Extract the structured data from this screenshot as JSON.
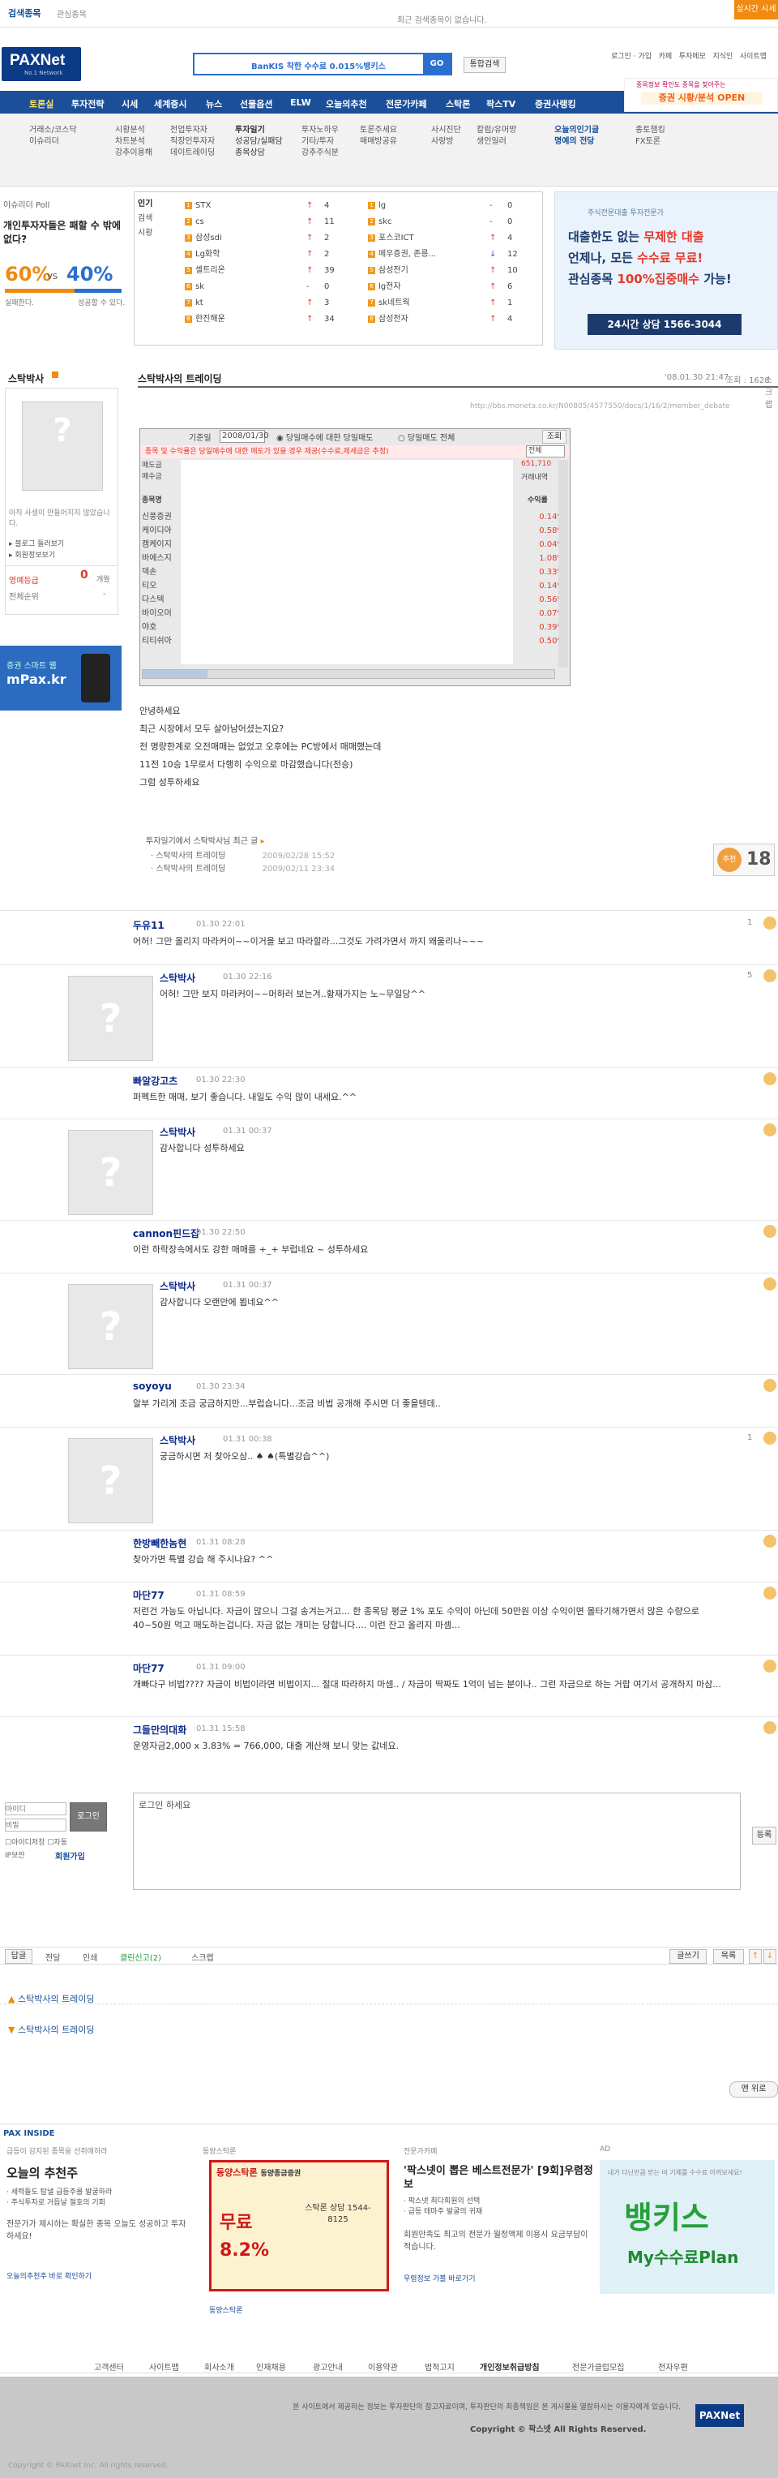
{
  "top": {
    "search_label": "검색종목",
    "stock_link": "관심종목",
    "notice": "최근 검색종목이 없습니다.",
    "live_button": "실시간 시세"
  },
  "header": {
    "logo": "PAXNet",
    "logo_sub": "No.1 Network",
    "search_banner": "BanKIS 착한 수수료 0.015%뱅키스",
    "go_button": "GO",
    "total_search_button": "통합검색",
    "links": [
      "로그인",
      "가입",
      "카페",
      "투자메모",
      "지식인",
      "사이트맵"
    ],
    "promo": "종목정보 확인도 종목을 찾아주는",
    "promo2": "증권 시황/분석 OPEN"
  },
  "nav": [
    "토론실",
    "투자전략",
    "시세",
    "세계증시",
    "뉴스",
    "선물옵션",
    "ELW",
    "오늘의추천",
    "전문가카페",
    "스탁론",
    "팍스TV",
    "증권사랭킹"
  ],
  "subnav": [
    [
      "거래소/코스닥",
      "이슈리더"
    ],
    [
      "시황분석",
      "차트분석",
      "강추이용해"
    ],
    [
      "전업투자자",
      "직장인투자자",
      "데이트레이딩"
    ],
    [
      "투자일기",
      "성공담/실패담",
      "종목상담"
    ],
    [
      "투자노하우",
      "기타/투자",
      "강추주식분"
    ],
    [
      "토론주세요",
      "매매방공유"
    ],
    [
      "사시진단",
      "사랑방"
    ],
    [
      "칼럼/유머방",
      "생인일러"
    ],
    [
      "오늘의인기글",
      "명예의 전당"
    ],
    [
      "종토챔킹",
      "FX토론"
    ]
  ],
  "poll": {
    "header": "이슈리더 Poll",
    "question": "개인투자자들은 패할 수 밖에 없다?",
    "pct_a": "60%",
    "vs": "VS",
    "pct_b": "40%",
    "label_a": "실패한다.",
    "label_b": "성공할 수 있다."
  },
  "ranking": {
    "side": [
      "인기",
      "검색",
      "시황"
    ],
    "left": [
      {
        "rank": "1",
        "name": "STX",
        "dir": "up",
        "change": "4"
      },
      {
        "rank": "2",
        "name": "cs",
        "dir": "up",
        "change": "11"
      },
      {
        "rank": "3",
        "name": "삼성sdi",
        "dir": "up",
        "change": "2"
      },
      {
        "rank": "4",
        "name": "Lg화학",
        "dir": "up",
        "change": "2"
      },
      {
        "rank": "5",
        "name": "셀트리온",
        "dir": "up",
        "change": "39"
      },
      {
        "rank": "6",
        "name": "sk",
        "dir": "none",
        "change": "0"
      },
      {
        "rank": "7",
        "name": "kt",
        "dir": "up",
        "change": "3"
      },
      {
        "rank": "8",
        "name": "한진해운",
        "dir": "up",
        "change": "34"
      }
    ],
    "right": [
      {
        "rank": "1",
        "name": "lg",
        "dir": "none",
        "change": "0"
      },
      {
        "rank": "2",
        "name": "skc",
        "dir": "none",
        "change": "0"
      },
      {
        "rank": "3",
        "name": "포스코ICT",
        "dir": "up",
        "change": "4"
      },
      {
        "rank": "4",
        "name": "메우증권, 존릉...",
        "dir": "dn",
        "change": "12"
      },
      {
        "rank": "5",
        "name": "삼성전기",
        "dir": "up",
        "change": "10"
      },
      {
        "rank": "6",
        "name": "lg전자",
        "dir": "up",
        "change": "6"
      },
      {
        "rank": "7",
        "name": "sk네트웍",
        "dir": "up",
        "change": "1"
      },
      {
        "rank": "8",
        "name": "삼성전자",
        "dir": "up",
        "change": "4"
      }
    ]
  },
  "ad_right": {
    "line1": "주식전문대출 투자전문가",
    "line2": "대출한도 없는",
    "hl1": "무제한 대출",
    "line3": "언제나, 모든",
    "hl2": "수수료 무료!",
    "line4": "관심종목",
    "hl3": "100%집중매수",
    "line5": "가능!",
    "phone": "24시간 상담 1566-3044"
  },
  "profile": {
    "name": "스탁박사",
    "note": "아직 사생이 만들어지지 않았습니다.",
    "blog": "블로그 들러보기",
    "book": "회원정보보기",
    "rank_label": "영예등급",
    "rank_value": "0",
    "rank_unit": "개월",
    "total_label": "전체순위",
    "total_value": "-",
    "mpax": "증권 스마트 웹",
    "mpax2": "mPax.kr"
  },
  "post": {
    "title": "스탁박사의 트레이딩",
    "date": "'08.01.30 21:47",
    "hits": "조회 : 1628",
    "extra": "스크랩",
    "url": "http://bbs.moneta.co.kr/N00805/4577550/docs/1/16/2/member_debate",
    "grid_date_label": "기준일",
    "grid_date": "2008/01/30",
    "grid_tab1": "당일매수에 대한 당일매도",
    "grid_tab2": "당일매도 전체",
    "grid_btn": "조회",
    "grid_all": "전체",
    "grid_warn": "종목 및 수익률은 당일매수에 대한 매도가 있을 경우 제공(수수료,제세금은 추정)",
    "left_head": [
      "매도금",
      "매수금"
    ],
    "col_name": "종목명",
    "col_yield": "수익률",
    "col_amt": "거래내역",
    "top_amt": "651,710",
    "names": [
      "신풍증권",
      "케이디아",
      "캠케이지",
      "바에스지",
      "덱손",
      "티오",
      "다스텍",
      "바이오머",
      "야호",
      "티티쉬아"
    ],
    "yields": [
      "0.14%",
      "0.58%",
      "0.04%",
      "1.08%",
      "0.33%",
      "0.14%",
      "0.56%",
      "0.07%",
      "0.39%",
      "0.50%"
    ],
    "body": [
      "안녕하세요",
      "최근 시장에서 모두 살아남어셨는지요?",
      "전 명량한계로 오전매매는 없었고 오후에는 PC방에서 매매했는데",
      "11전 10승 1무로서 다행히 수익으로 마감했습니다(전승)",
      "그럼 성투하세요"
    ],
    "related_title": "투자일기에서 스탁박사님 최근 글",
    "related": [
      {
        "title": "스탁박사의 트레이딩",
        "date": "2009/02/28 15:52"
      },
      {
        "title": "스탁박사의 트레이딩",
        "date": "2009/02/11 23:34"
      }
    ],
    "recommend_label": "추천",
    "recommend": "18"
  },
  "comments": [
    {
      "name": "두유11",
      "date": "01.30 22:01",
      "text": "어허! 그만 올리지 마라커이~~이거을 보고 따라할라...그것도 가려가면서 까지 왜울리나~~~",
      "badge": "1"
    },
    {
      "name": "스탁박사",
      "date": "01.30 22:16",
      "text": "어허! 그만 보지 마라커이~~머하러 보는겨..황재가지는 노~무일당^^",
      "reply": true,
      "badge": "5"
    },
    {
      "name": "빠알강고츠",
      "date": "01.30 22:30",
      "text": "퍼펙트한 매매, 보기 좋습니다. 내일도 수익 많이 내세요.^^"
    },
    {
      "name": "스탁박사",
      "date": "01.31 00:37",
      "text": "감사합니다 성투하세요",
      "reply": true
    },
    {
      "name": "cannon핀드잡",
      "date": "01.30 22:50",
      "text": "이런 하락장속에서도 강한 매매를 +_+ 부럽네요 ~ 성투하세요"
    },
    {
      "name": "스탁박사",
      "date": "01.31 00:37",
      "text": "감사합니다 오랜만에 뵙네요^^",
      "reply": true
    },
    {
      "name": "soyoyu",
      "date": "01.30 23:34",
      "text": "알부 가리게 조금 궁금하지만...부럽습니다...조금 비법 공개해 주시면 더 좋을텐데.."
    },
    {
      "name": "스탁박사",
      "date": "01.31 00:38",
      "text": "궁금하시면 저 찾아오삼.. ♠ ♠(특별강습^^)",
      "reply": true,
      "badge": "1"
    },
    {
      "name": "한방빼한놈현",
      "date": "01.31 08:28",
      "text": "찾아가면 특별 강습 해 주시나요? ^^"
    },
    {
      "name": "마단77",
      "date": "01.31 08:59",
      "text": "저런건 가능도 아닙니다. 자금이 많으니 그걸 송겨는거고... 한 종목당 평균 1% 포도 수익이 아닌데 50만원 이상 수익이면 몰타기해가면서 많은 수량으로 40~50원 먹고 매도하는겁니다. 자금 없는 개미는 당합니다.... 이런 잔고 올리지 마셈..."
    },
    {
      "name": "마단77",
      "date": "01.31 09:00",
      "text": "개빠다구 비법???? 자금이 비법이라면 비법이지... 절대 따라하지 마셈.. / 자금이 딱짜도 1억이 넘는 분이나.. 그런 자금으로 하는 거랍 여기서 공개하지 마삼..."
    },
    {
      "name": "그들만의대화",
      "date": "01.31 15:58",
      "text": "운영자금2,000 x 3.83% = 766,000, 대출 계산해 보니 맞는 값네요."
    }
  ],
  "comment_form": {
    "id_placeholder": "아이디",
    "pw_placeholder": "비밀",
    "login_button": "로그인",
    "save_id": "아이디저장",
    "auto": "자동",
    "ip_label": "IP보안",
    "join": "회원가입",
    "placeholder": "로그인 하세요",
    "submit": "등록"
  },
  "toolbar": {
    "left": [
      "답글",
      "전달",
      "인쇄",
      "클린신고",
      "스크랩"
    ],
    "clean_count": "2",
    "right": [
      "글쓰기",
      "목록"
    ]
  },
  "bottom_links": [
    "스탁박사의 트레이딩",
    "스탁박사의 트레이딩"
  ],
  "up_button": "맨 위로",
  "pax_inside": {
    "title": "PAX INSIDE",
    "col1_head": "급등이 감지된 종목을 선취매하라",
    "col1_title": "오늘의 추천주",
    "col1_items": [
      "세력들도 탐낼 급등주를 발굴하라",
      "주식투자로 거듭날 절호의 기회"
    ],
    "col1_text": "전문가가 제시하는 확실한 종목 오늘도 성공하고 투자하세요!",
    "col1_link": "오늘의추천주 바로 확인하기",
    "col2_head": "동양스탁론",
    "col2_brand": "동양스탁론",
    "col2_sub": "동양종금증권",
    "col2_rate": "8.2%",
    "col2_hot": "무료",
    "col2_phone": "스탁론 상담 1544-8125",
    "col2_link": "동양스탁론",
    "col3_head": "전문가카페",
    "col3_title": "'팍스넷이 뽑은 베스트전문가' [9회]우렴정보",
    "col3_items": [
      "팍스넷 최다회원의 선택",
      "급등 테마주 발굴의 귀재"
    ],
    "col3_text": "회원만족도 최고의 전문가 월정액제 이용시 요금부담이 적습니다.",
    "col3_link": "우렴정보 가볼 바로가기",
    "col4_head": "AD",
    "col4_top": "내가 다닌만큼 받는 비 기체를 수수료 아꺼보세요!",
    "col4_big": "뱅키스",
    "col4_sub": "My수수료Plan"
  },
  "footer": {
    "links": [
      "고객센터",
      "사이트맵",
      "회사소개",
      "인재채용",
      "광고안내",
      "이용약관",
      "법적고지",
      "개인정보취급방침",
      "전문가클럽모집",
      "전자우편"
    ],
    "disclaimer": "본 사이트에서 제공하는 정보는 투자판단의 참고자료이며, 투자판단의 최종책임은 본 게시물을 열람하시는 이용자에게 있습니다.",
    "copyright": "Copyright © 팍스넷 All Rights Reserved.",
    "bottom": "Copyright © PAXnet Inc. All rights reserved."
  }
}
